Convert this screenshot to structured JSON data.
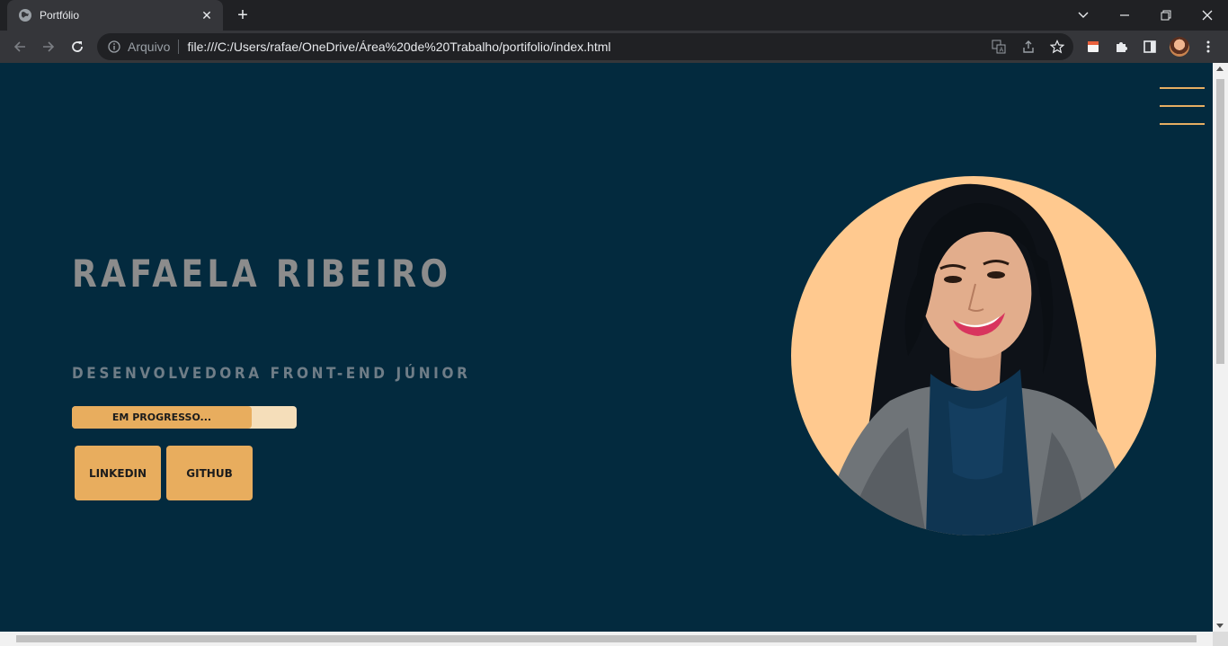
{
  "browser": {
    "tab": {
      "title": "Portfólio"
    },
    "omnibox": {
      "scheme_label": "Arquivo",
      "url": "file:///C:/Users/rafae/OneDrive/Área%20de%20Trabalho/portifolio/index.html"
    },
    "colors": {
      "tabstrip": "#202124",
      "toolbar": "#35363a",
      "omnibox": "#202124"
    }
  },
  "page": {
    "colors": {
      "background": "#032a3e",
      "accent": "#e8ad5e",
      "accent_light": "#f5deba",
      "photo_bg": "#ffc98f"
    },
    "name": "RAFAELA RIBEIRO",
    "role": "DESENVOLVEDORA FRONT-END JÚNIOR",
    "progress": {
      "label": "EM PROGRESSO...",
      "percent": 80
    },
    "buttons": {
      "linkedin": "LINKEDIN",
      "github": "GITHUB"
    },
    "photo": {
      "icon": "profile-photo"
    },
    "menu": {
      "icon": "hamburger-menu-icon"
    }
  }
}
